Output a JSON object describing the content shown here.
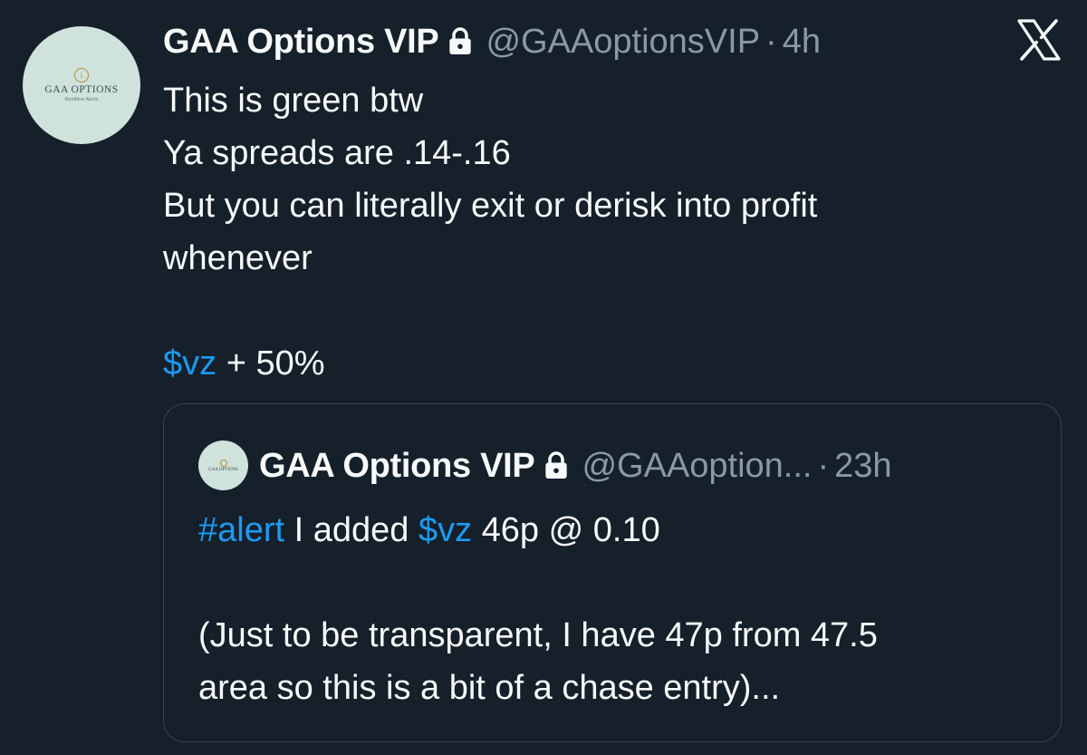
{
  "tweet": {
    "avatar": {
      "logo_name": "GAA OPTIONS",
      "logo_sub": "Realtime Alerts",
      "logo_mark": "i"
    },
    "display_name": "GAA Options VIP",
    "lock_icon": "lock-icon",
    "handle": "@GAAoptionsVIP",
    "separator": "·",
    "time": "4h",
    "platform_icon": "x-logo-icon",
    "lines": [
      "This is green btw",
      "Ya spreads are .14-.16",
      "But you can literally exit or derisk into profit",
      "whenever",
      ""
    ],
    "ticker": "$vz",
    "ticker_suffix": " + 50%"
  },
  "quoted_tweet": {
    "avatar": {
      "logo_name": "GAA OPTIONS"
    },
    "display_name": "GAA Options VIP",
    "handle": "@GAAoption...",
    "separator": "·",
    "time": "23h",
    "hashtag": "#alert",
    "text_part1": " I added ",
    "ticker": "$vz",
    "text_part2": " 46p @ 0.10",
    "lines": [
      "",
      "(Just to be transparent, I have 47p from 47.5",
      "area so this is a bit of a chase entry)..."
    ]
  },
  "colors": {
    "background": "#15202b",
    "text": "#f7f9f9",
    "secondary": "#8b98a5",
    "link": "#1d9bf0",
    "border": "#38444d"
  }
}
